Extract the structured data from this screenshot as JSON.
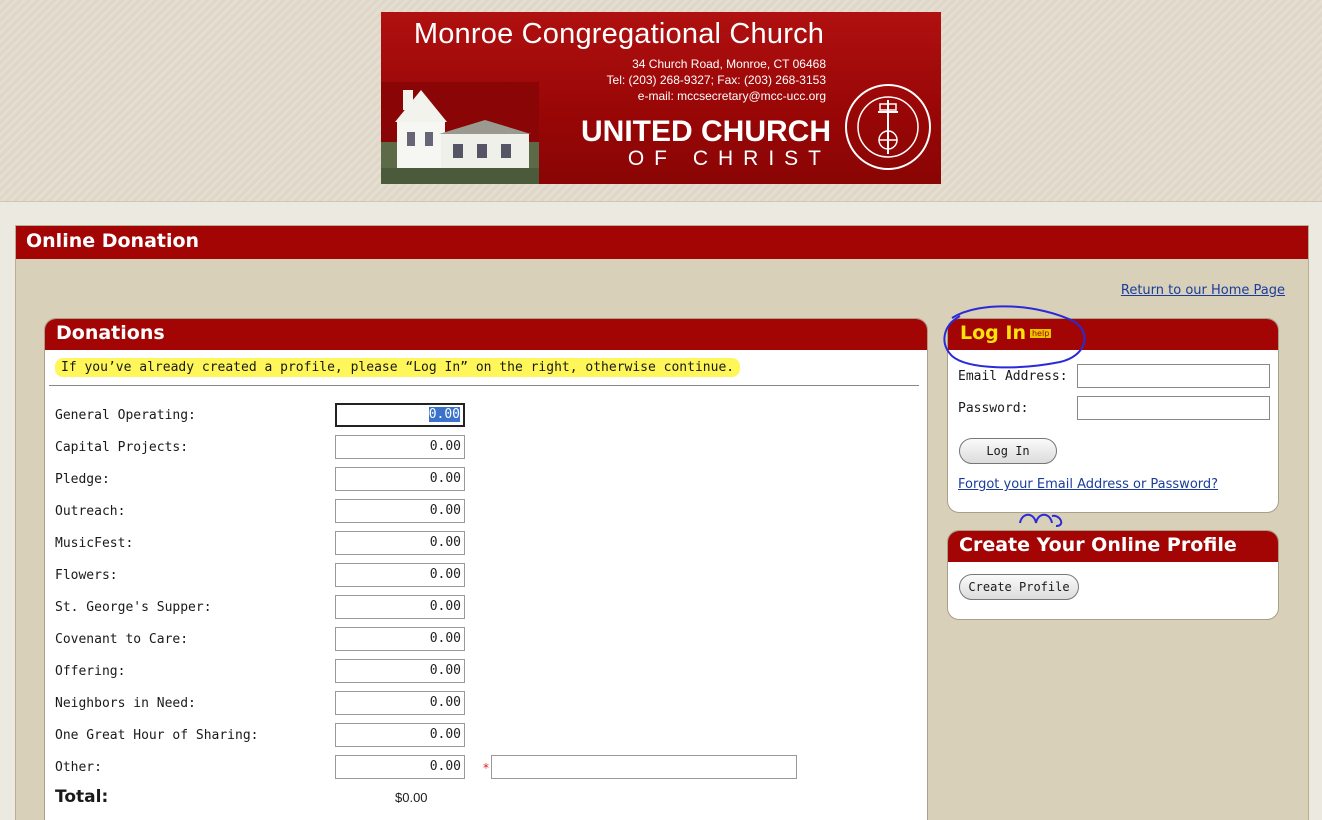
{
  "banner": {
    "church_name": "Monroe Congregational Church",
    "address": "34 Church Road, Monroe, CT  06468",
    "phone": "Tel: (203) 268-9327; Fax: (203) 268-3153",
    "email": "e-mail: mccsecretary@mcc-ucc.org",
    "ucc_line1": "UNITED CHURCH",
    "ucc_line2": "OF CHRIST",
    "seal_text": "UNITED CHURCH OF CHRIST · THAT THEY MAY ALL BE ONE"
  },
  "page": {
    "title": "Online Donation",
    "home_link": "Return to our Home Page"
  },
  "donations": {
    "title": "Donations",
    "notice": "If you’ve already created a profile, please “Log In” on the right, otherwise continue.",
    "rows": [
      {
        "label": "General Operating:",
        "value": "0.00"
      },
      {
        "label": "Capital Projects:",
        "value": "0.00"
      },
      {
        "label": "Pledge:",
        "value": "0.00"
      },
      {
        "label": "Outreach:",
        "value": "0.00"
      },
      {
        "label": "MusicFest:",
        "value": "0.00"
      },
      {
        "label": "Flowers:",
        "value": "0.00"
      },
      {
        "label": "St. George's Supper:",
        "value": "0.00"
      },
      {
        "label": "Covenant to Care:",
        "value": "0.00"
      },
      {
        "label": "Offering:",
        "value": "0.00"
      },
      {
        "label": "Neighbors in Need:",
        "value": "0.00"
      },
      {
        "label": "One Great Hour of Sharing:",
        "value": "0.00"
      },
      {
        "label": "Other:",
        "value": "0.00"
      }
    ],
    "required_mark": "*",
    "other_description": "",
    "total_label": "Total:",
    "total_value": "$0.00"
  },
  "login": {
    "title": "Log In",
    "help": "help",
    "email_label": "Email Address:",
    "email_value": "",
    "password_label": "Password:",
    "password_value": "",
    "button": "Log In",
    "forgot": "Forgot your Email Address or Password?"
  },
  "profile": {
    "title": "Create Your Online Profile",
    "button": "Create Profile"
  },
  "colors": {
    "header_red": "#a30404",
    "highlight_yellow": "#fff65a",
    "panel_bg": "#d9d0b9",
    "link_blue": "#1a3c9c",
    "annotation_blue": "#2a2ad8"
  }
}
